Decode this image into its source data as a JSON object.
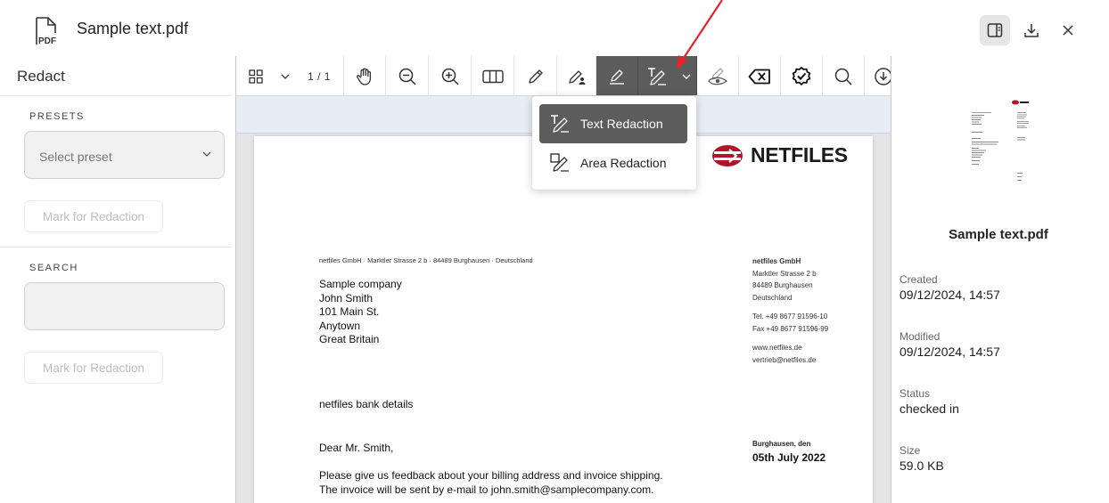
{
  "header": {
    "title": "Sample text.pdf",
    "pdf_icon_label": "PDF",
    "icons": [
      "pdf-file-icon",
      "sidebar-toggle-icon",
      "download-icon",
      "close-icon"
    ]
  },
  "redact_panel": {
    "title": "Redact",
    "presets_label": "PRESETS",
    "preset_placeholder": "Select preset",
    "mark_label_1": "Mark for Redaction",
    "search_label": "SEARCH",
    "search_value": "",
    "mark_label_2": "Mark for Redaction"
  },
  "toolbar": {
    "page_indicator": "1 / 1",
    "icons": [
      "grid-icon",
      "chevron-down-icon",
      "hand-icon",
      "zoom-out-icon",
      "zoom-in-icon",
      "two-page-icon",
      "pencil-icon",
      "pen-user-icon",
      "highlighter-icon",
      "text-redaction-icon",
      "redaction-dropdown-chevron-icon",
      "eye-pen-icon",
      "clear-icon",
      "badge-check-icon",
      "search-icon",
      "save-icon"
    ]
  },
  "redaction_menu": {
    "items": [
      {
        "label": "Text Redaction",
        "icon": "text-redaction-icon",
        "active": true
      },
      {
        "label": "Area Redaction",
        "icon": "area-redaction-icon",
        "active": false
      }
    ]
  },
  "document": {
    "logo_text": "NETFILES",
    "sender_line": "netfiles GmbH  ·  Marktler Strasse 2 b  ·  84489 Burghausen  ·  Deutschland",
    "recipient": [
      "Sample company",
      "John Smith",
      "101 Main St.",
      "Anytown",
      "Great Britain"
    ],
    "company_name": "netfiles GmbH",
    "company_address": [
      "Marktler Strasse 2 b",
      "84489 Burghausen",
      "Deutschland"
    ],
    "company_phone": [
      "Tel. +49 8677 91596-10",
      "Fax +49 8677 91596-99"
    ],
    "company_web": [
      "www.netfiles.de",
      "vertrieb@netfiles.de"
    ],
    "bank_details": "netfiles bank details",
    "salutation": "Dear Mr. Smith,",
    "date_place": "Burghausen, den",
    "date": "05th July 2022",
    "body": [
      "Please give us feedback about your billing address and invoice shipping.",
      "The invoice will be sent by e-mail to john.smith@samplecompany.com."
    ]
  },
  "info_panel": {
    "file_name": "Sample text.pdf",
    "created_label": "Created",
    "created_value": "09/12/2024, 14:57",
    "modified_label": "Modified",
    "modified_value": "09/12/2024, 14:57",
    "status_label": "Status",
    "status_value": "checked in",
    "size_label": "Size",
    "size_value": "59.0 KB"
  },
  "colors": {
    "toolbar_active": "#5c5c5c",
    "viewer_strip": "#e6edf7",
    "logo_red": "#b0142b",
    "annotation_arrow": "#e8222a"
  }
}
